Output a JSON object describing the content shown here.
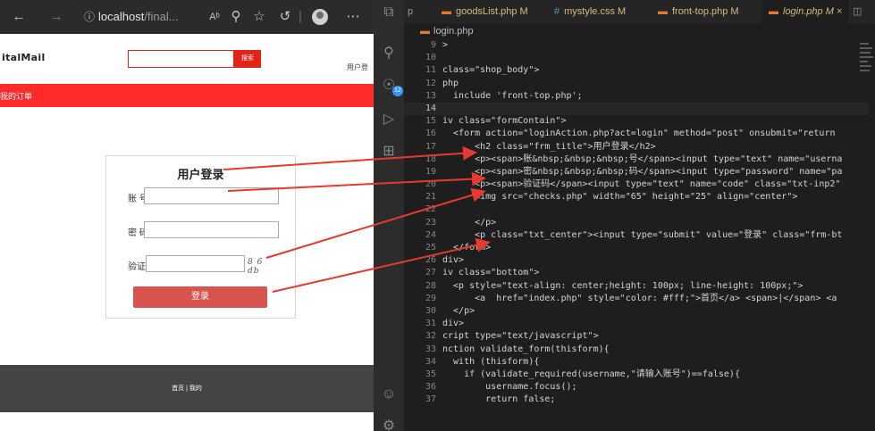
{
  "browser": {
    "url_host": "localhost",
    "url_path": "/final...",
    "back_icon": "arrow-left-icon",
    "forward_icon": "arrow-right-icon",
    "info_icon": "info-icon",
    "read_aloud_icon": "read-aloud-icon",
    "zoom_icon": "zoom-icon",
    "favorite_icon": "star-plus-icon",
    "extensions_icon": "extensions-icon",
    "profile_icon": "avatar-icon",
    "more_icon": "ellipsis-icon"
  },
  "page": {
    "logo": "italMail",
    "search_button": "搜索",
    "search_placeholder": "",
    "login_link": "用户登",
    "nav_link": "我的订单",
    "form": {
      "title": "用户登录",
      "account_label": "账  号",
      "password_label": "密  码",
      "captcha_label": "验证码",
      "captcha_text": "8 6 db",
      "submit": "登录"
    },
    "footer": "首页 | 我的"
  },
  "activity_bar": {
    "icons": [
      "copy-icon",
      "search-icon",
      "source-control-icon",
      "run-debug-icon",
      "extensions-icon",
      "account-icon",
      "settings-icon"
    ],
    "badge": "12"
  },
  "editor": {
    "tabs": [
      {
        "label": "goodsList.php M"
      },
      {
        "label": "mystyle.css M"
      },
      {
        "label": "front-top.php M"
      },
      {
        "label": "login.php M  ×"
      }
    ],
    "partial_tab": "p",
    "breadcrumb": "login.php",
    "lines": [
      {
        "n": "9",
        "t": ">"
      },
      {
        "n": "10",
        "t": ""
      },
      {
        "n": "11",
        "t": "class=\"shop_body\">"
      },
      {
        "n": "12",
        "t": "php"
      },
      {
        "n": "13",
        "t": "  include 'front-top.php';"
      },
      {
        "n": "14",
        "t": ""
      },
      {
        "n": "15",
        "t": "iv class=\"formContain\">"
      },
      {
        "n": "16",
        "t": "  <form action=\"loginAction.php?act=login\" method=\"post\" onsubmit=\"return"
      },
      {
        "n": "17",
        "t": "      <h2 class=\"frm_title\">用户登录</h2>"
      },
      {
        "n": "18",
        "t": "      <p><span>账&nbsp;&nbsp;&nbsp;号</span><input type=\"text\" name=\"userna"
      },
      {
        "n": "19",
        "t": "      <p><span>密&nbsp;&nbsp;&nbsp;码</span><input type=\"password\" name=\"pa"
      },
      {
        "n": "20",
        "t": "      <p><span>验证码</span><input type=\"text\" name=\"code\" class=\"txt-inp2\""
      },
      {
        "n": "21",
        "t": "      <img src=\"checks.php\" width=\"65\" height=\"25\" align=\"center\">"
      },
      {
        "n": "22",
        "t": ""
      },
      {
        "n": "23",
        "t": "      </p>"
      },
      {
        "n": "24",
        "t": "      <p class=\"txt_center\"><input type=\"submit\" value=\"登录\" class=\"frm-bt"
      },
      {
        "n": "25",
        "t": "  </form>"
      },
      {
        "n": "26",
        "t": "div>"
      },
      {
        "n": "27",
        "t": "iv class=\"bottom\">"
      },
      {
        "n": "28",
        "t": "  <p style=\"text-align: center;height: 100px; line-height: 100px;\">"
      },
      {
        "n": "29",
        "t": "      <a  href=\"index.php\" style=\"color: #fff;\">首页</a> <span>|</span> <a"
      },
      {
        "n": "30",
        "t": "  </p>"
      },
      {
        "n": "31",
        "t": "div>"
      },
      {
        "n": "32",
        "t": "cript type=\"text/javascript\">"
      },
      {
        "n": "33",
        "t": "nction validate_form(thisform){"
      },
      {
        "n": "34",
        "t": "  with (thisform){"
      },
      {
        "n": "35",
        "t": "    if (validate_required(username,\"请输入账号\")==false){"
      },
      {
        "n": "36",
        "t": "        username.focus();"
      },
      {
        "n": "37",
        "t": "        return false;"
      }
    ]
  },
  "colors": {
    "accent_red": "#e2231a",
    "nav_red": "#ff2a2a",
    "login_button": "#d9534f",
    "arrow": "#e53a2f",
    "badge_blue": "#3794ff"
  }
}
